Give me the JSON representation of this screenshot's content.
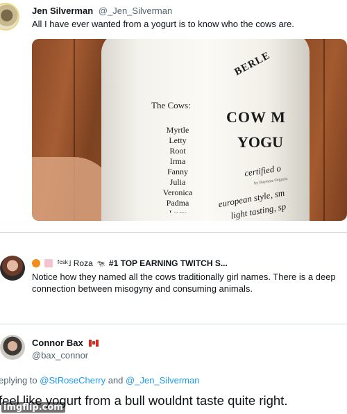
{
  "tweet1": {
    "display_name": "Jen Silverman",
    "handle": "@_Jen_Silverman",
    "text": "All I have ever wanted from a yogurt is to know who the cows are.",
    "photo": {
      "cows_title": "The Cows:",
      "cows": [
        "Myrtle",
        "Letty",
        "Root",
        "Irma",
        "Fanny",
        "Julia",
        "Veronica",
        "Padma",
        "Lucy"
      ],
      "brand": "BERLE",
      "product_line1": "COW M",
      "product_line2": "YOGU",
      "certified": "certified o",
      "by_line": "by Baystate Organic",
      "tag_line1": "european style, sm",
      "tag_line2": "light tasting, sp"
    }
  },
  "tweet2": {
    "display_name": "ᶠᶜˢᵏ˩ Roza",
    "display_suffix": "#1 TOP EARNING TWITCH S...",
    "emojis": [
      "pumpkin-emoji",
      "cake-emoji",
      "cow-emoji"
    ],
    "text": "Notice how they named all the cows traditionally girl names. There is a deep connection between misogyny and consuming animals."
  },
  "tweet3": {
    "display_name": "Connor Bax",
    "handle": "@bax_connor",
    "replying_prefix": "eplying to ",
    "replying_mention1": "@StRoseCherry",
    "replying_and": " and ",
    "replying_mention2": "@_Jen_Silverman",
    "text": "feel like yogurt from a bull wouldnt taste quite right."
  },
  "watermark": "imgflip.com",
  "colors": {
    "link": "#1d9bf0",
    "secondary_text": "#536471",
    "divider": "#cfd9de"
  }
}
